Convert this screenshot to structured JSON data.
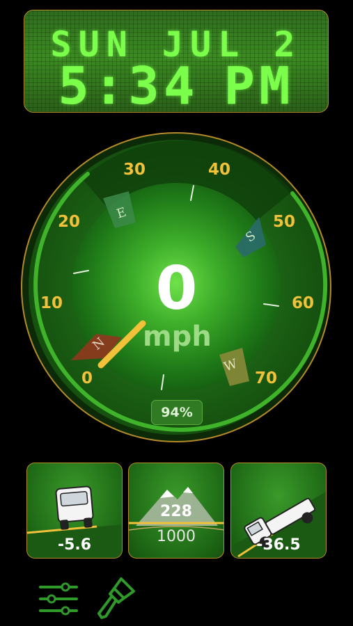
{
  "clock": {
    "date": "SUN JUL 2",
    "time": "5:34",
    "ampm": "PM"
  },
  "speedometer": {
    "speed": "0",
    "unit": "mph",
    "battery": "94%",
    "scale_labels": [
      "0",
      "10",
      "20",
      "30",
      "40",
      "50",
      "60",
      "70"
    ],
    "compass": {
      "north": "N",
      "east": "E",
      "south": "S",
      "west": "W"
    }
  },
  "tiles": {
    "roll": {
      "value": "-5.6"
    },
    "altitude": {
      "value": "228",
      "reference": "1000"
    },
    "pitch": {
      "value": "-36.5"
    }
  },
  "toolbar": {
    "settings_icon": "sliders-icon",
    "theme_icon": "paintbrush-icon"
  },
  "colors": {
    "accent_yellow": "#f2c13a",
    "lcd_green": "#7cff4a",
    "bezel": "#b58b2a",
    "ring_green": "#3fb32a"
  }
}
